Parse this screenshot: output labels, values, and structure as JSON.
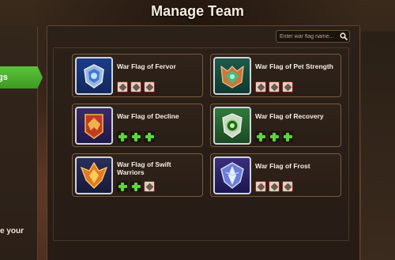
{
  "header": {
    "title": "Manage Team"
  },
  "search": {
    "placeholder": "Enter war flag name..."
  },
  "left_panel": {
    "tab_label": "gs",
    "bottom_text": "e your"
  },
  "flags": [
    {
      "name": "War Flag of Fervor",
      "icon": "fervor-flag-icon",
      "slots": [
        "rune",
        "rune",
        "rune"
      ]
    },
    {
      "name": "War Flag of Pet Strength",
      "icon": "pet-strength-flag-icon",
      "slots": [
        "rune",
        "rune",
        "rune"
      ]
    },
    {
      "name": "War Flag of Decline",
      "icon": "decline-flag-icon",
      "slots": [
        "plus",
        "plus",
        "plus"
      ]
    },
    {
      "name": "War Flag of Recovery",
      "icon": "recovery-flag-icon",
      "slots": [
        "plus",
        "plus",
        "plus"
      ]
    },
    {
      "name": "War Flag of Swift Warriors",
      "icon": "swift-warriors-flag-icon",
      "slots": [
        "plus",
        "plus",
        "rune"
      ]
    },
    {
      "name": "War Flag of Frost",
      "icon": "frost-flag-icon",
      "slots": [
        "rune",
        "rune",
        "rune"
      ]
    }
  ],
  "colors": {
    "accent_green": "#5bd63a",
    "card_border": "#7a5a3a",
    "rune_border": "#a41818"
  }
}
